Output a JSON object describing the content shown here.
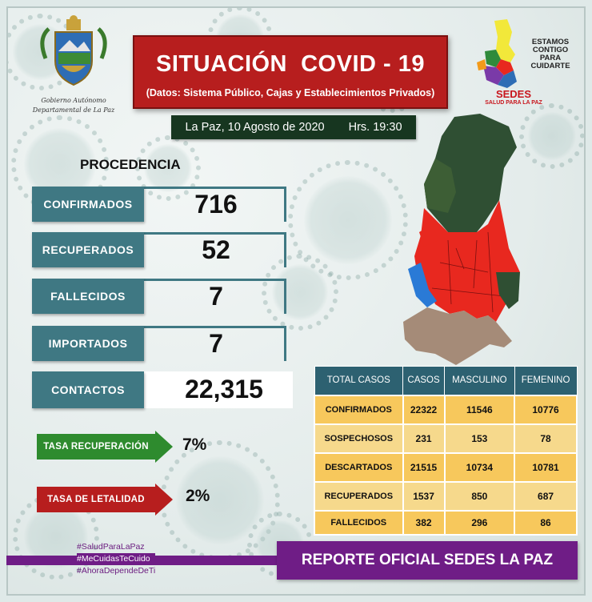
{
  "header": {
    "title": "SITUACIÓN  COVID - 19",
    "subtitle": "(Datos: Sistema Público, Cajas y Establecimientos Privados)",
    "date": "La Paz, 10 Agosto de 2020",
    "time": "Hrs. 19:30"
  },
  "logos": {
    "gov_line1": "Gobierno Autónomo",
    "gov_line2": "Departamental de La Paz",
    "sedes_name": "SEDES",
    "sedes_tagline": "SALUD PARA LA PAZ",
    "campaign": [
      "ESTAMOS",
      "CONTIGO",
      "PARA",
      "CUIDARTE"
    ]
  },
  "procedencia": {
    "heading": "PROCEDENCIA",
    "items": [
      {
        "label": "CONFIRMADOS",
        "value": "716"
      },
      {
        "label": "RECUPERADOS",
        "value": "52"
      },
      {
        "label": "FALLECIDOS",
        "value": "7"
      },
      {
        "label": "IMPORTADOS",
        "value": "7"
      },
      {
        "label": "CONTACTOS",
        "value": "22,315"
      }
    ]
  },
  "rates": {
    "recovery_label": "TASA RECUPERACIÓN",
    "recovery_value": "7%",
    "lethality_label": "TASA  DE LETALIDAD",
    "lethality_value": "2%"
  },
  "table": {
    "headers": [
      "TOTAL CASOS",
      "CASOS",
      "MASCULINO",
      "FEMENINO"
    ],
    "rows": [
      [
        "CONFIRMADOS",
        "22322",
        "11546",
        "10776"
      ],
      [
        "SOSPECHOSOS",
        "231",
        "153",
        "78"
      ],
      [
        "DESCARTADOS",
        "21515",
        "10734",
        "10781"
      ],
      [
        "RECUPERADOS",
        "1537",
        "850",
        "687"
      ],
      [
        "FALLECIDOS",
        "382",
        "296",
        "86"
      ]
    ]
  },
  "hashtags": [
    "#SaludParaLaPaz",
    "#MeCuidasTeCuido",
    "#AhoraDependeDeTi"
  ],
  "footer": "REPORTE OFICIAL SEDES LA PAZ",
  "colors": {
    "title_red": "#b71e1e",
    "teal": "#3f7883",
    "dark_green": "#173620",
    "arrow_green": "#2e8b2e",
    "arrow_red": "#b71e1e",
    "table_header": "#2d6171",
    "table_cell": "#f6d98c",
    "purple": "#6f1d86",
    "map_red": "#e8281f",
    "map_green": "#2f4f33",
    "map_blue": "#2a7ad6"
  }
}
